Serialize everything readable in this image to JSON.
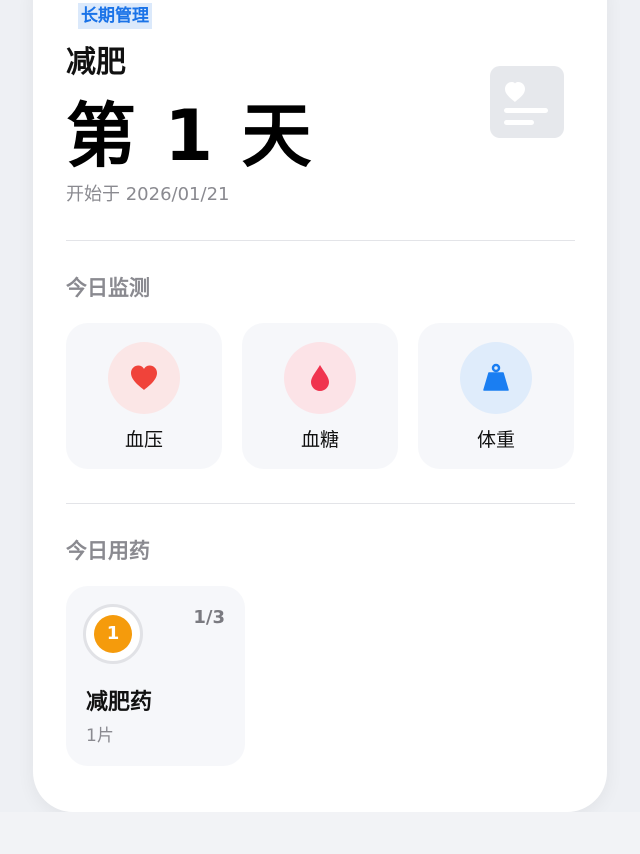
{
  "plan": {
    "tag": "长期管理",
    "goal": "减肥",
    "day": "第 1 天",
    "start": "开始于 2026/01/21"
  },
  "monitoring": {
    "title": "今日监测",
    "items": [
      {
        "label": "血压",
        "icon": "heart-icon",
        "color": "#f0433a",
        "bg": "#fbe6e6"
      },
      {
        "label": "血糖",
        "icon": "blood-drop-icon",
        "color": "#f0344f",
        "bg": "#fce3e7"
      },
      {
        "label": "体重",
        "icon": "weight-scale-icon",
        "color": "#1a7ef2",
        "bg": "#dfecfb"
      }
    ]
  },
  "medication": {
    "title": "今日用药",
    "items": [
      {
        "index": "1",
        "progress": "1/3",
        "name": "减肥药",
        "dose": "1片",
        "color": "#f59b0c"
      }
    ]
  }
}
